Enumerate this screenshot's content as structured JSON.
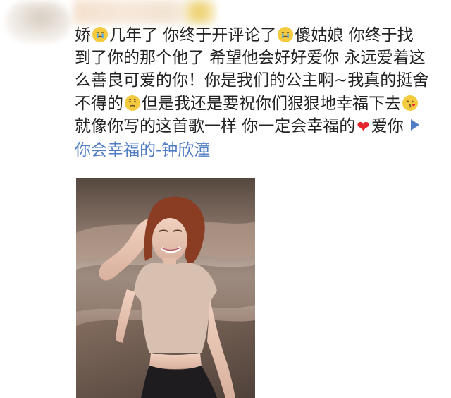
{
  "comment": {
    "line1": {
      "t1": "娇",
      "t2": "几年了 你终于开评论了",
      "t3": "傻姑娘 你终于找"
    },
    "line2": "到了你的那个他了 希望他会好好爱你 永远爱着这",
    "line3": "么善良可爱的你！你是我们的公主啊~我真的挺舍",
    "line4": {
      "t1": "不得的",
      "t2": "但是我还是要祝你们狠狠地幸福下去"
    },
    "line5": {
      "t1": "就像你写的这首歌一样 你一定会幸福的",
      "t2": "爱你"
    },
    "song_link": "你会幸福的-钟欣潼"
  },
  "icons": {
    "emoji_1": "crying-face-icon",
    "emoji_2": "crying-face-icon",
    "emoji_3": "worried-face-icon",
    "emoji_4": "kiss-face-icon",
    "heart": "heart-icon",
    "play": "play-icon"
  },
  "colors": {
    "text": "#222222",
    "link": "#4f7cc3",
    "heart": "#e3262b"
  }
}
